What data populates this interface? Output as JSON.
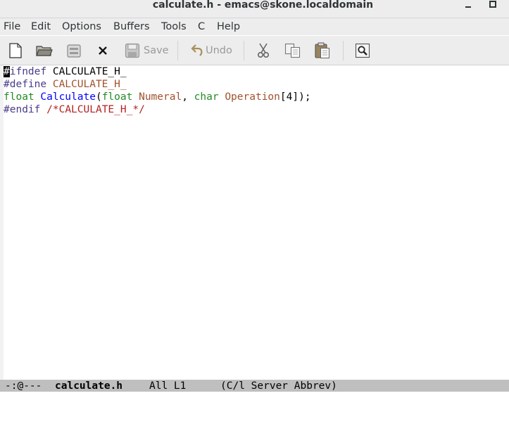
{
  "window": {
    "title": "calculate.h - emacs@skone.localdomain",
    "minimize_glyph": "—",
    "maximize_glyph": "□"
  },
  "menu": [
    "File",
    "Edit",
    "Options",
    "Buffers",
    "Tools",
    "C",
    "Help"
  ],
  "toolbar": {
    "new_icon": "new-file-icon",
    "open_icon": "open-folder-icon",
    "dired_icon": "dired-icon",
    "close_icon": "close-buffer-icon",
    "save_label": "Save",
    "undo_label": "Undo",
    "cut_icon": "scissors-icon",
    "copy_icon": "copy-icon",
    "paste_icon": "paste-icon",
    "search_icon": "search-icon",
    "disabled_color": "#9a9a9a"
  },
  "editor": {
    "lines": [
      [
        {
          "text": "#",
          "style": "cursor"
        },
        {
          "text": "ifndef",
          "style": "pre"
        },
        {
          "text": " CALCULATE_H_",
          "style": "plain"
        }
      ],
      [
        {
          "text": "#define",
          "style": "pre"
        },
        {
          "text": " ",
          "style": "plain"
        },
        {
          "text": "CALCULATE_H_",
          "style": "var"
        }
      ],
      [
        {
          "text": "float",
          "style": "type"
        },
        {
          "text": " ",
          "style": "plain"
        },
        {
          "text": "Calculate",
          "style": "fn"
        },
        {
          "text": "(",
          "style": "plain"
        },
        {
          "text": "float",
          "style": "type"
        },
        {
          "text": " ",
          "style": "plain"
        },
        {
          "text": "Numeral",
          "style": "var"
        },
        {
          "text": ", ",
          "style": "plain"
        },
        {
          "text": "char",
          "style": "type"
        },
        {
          "text": " ",
          "style": "plain"
        },
        {
          "text": "Operation",
          "style": "var"
        },
        {
          "text": "[4]);",
          "style": "plain"
        }
      ],
      [
        {
          "text": "#endif",
          "style": "pre"
        },
        {
          "text": " ",
          "style": "plain"
        },
        {
          "text": "/*CALCULATE_H_*/",
          "style": "cmt"
        }
      ]
    ]
  },
  "modeline": {
    "status": "-:@---",
    "buffer_name": "calculate.h",
    "position": "All L1",
    "modes": "(C/l Server Abbrev)"
  }
}
